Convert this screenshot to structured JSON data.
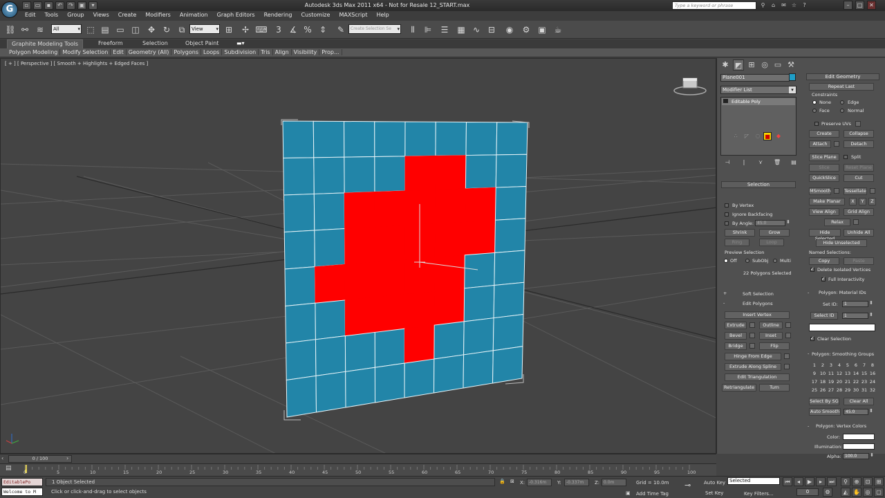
{
  "title": "Autodesk 3ds Max  2011 x64    - Not for Resale    12_START.max",
  "search_placeholder": "Type a keyword or phrase",
  "app_logo": "G",
  "menu": [
    "Edit",
    "Tools",
    "Group",
    "Views",
    "Create",
    "Modifiers",
    "Animation",
    "Graph Editors",
    "Rendering",
    "Customize",
    "MAXScript",
    "Help"
  ],
  "toolbar": {
    "selection_filter": "All",
    "ref_coord": "View",
    "named_selection": "Create Selection Se"
  },
  "ribbon": {
    "tabs": [
      "Graphite Modeling Tools",
      "Freeform",
      "Selection",
      "Object Paint"
    ],
    "sub": [
      "Polygon Modeling",
      "Modify Selection",
      "Edit",
      "Geometry (All)",
      "Polygons",
      "Loops",
      "Subdivision",
      "Tris",
      "Align",
      "Visibility",
      "Prop..."
    ]
  },
  "viewport": {
    "label": "[ + ] [ Perspective ] [ Smooth + Highlights + Edged Faces ]",
    "accent": "#2285a8",
    "selected_color": "#ff0000"
  },
  "panel": {
    "object_name": "Plane001",
    "modifier_list": "Modifier List",
    "stack_item": "Editable Poly",
    "selection": {
      "title": "Selection",
      "by_vertex": "By Vertex",
      "ignore_backfacing": "Ignore Backfacing",
      "by_angle": "By Angle:",
      "by_angle_value": "45.0",
      "shrink": "Shrink",
      "grow": "Grow",
      "ring": "Ring",
      "loop": "Loop",
      "preview_selection": "Preview Selection",
      "preview_off": "Off",
      "preview_subobj": "SubObj",
      "preview_multi": "Multi",
      "status": "22 Polygons Selected"
    },
    "soft_selection": "Soft Selection",
    "edit_polygons": {
      "title": "Edit Polygons",
      "insert_vertex": "Insert Vertex",
      "extrude": "Extrude",
      "outline": "Outline",
      "bevel": "Bevel",
      "inset": "Inset",
      "bridge": "Bridge",
      "flip": "Flip",
      "hinge_from_edge": "Hinge From Edge",
      "extrude_along_spline": "Extrude Along Spline",
      "edit_triangulation": "Edit Triangulation",
      "retriangulate": "Retriangulate",
      "turn": "Turn"
    },
    "edit_geometry": {
      "title": "Edit Geometry",
      "repeat_last": "Repeat Last",
      "constraints": "Constraints",
      "none": "None",
      "edge": "Edge",
      "face": "Face",
      "normal": "Normal",
      "preserve_uvs": "Preserve UVs",
      "create": "Create",
      "collapse": "Collapse",
      "attach": "Attach",
      "detach": "Detach",
      "slice_plane": "Slice Plane",
      "split": "Split",
      "slice": "Slice",
      "reset_plane": "Reset Plane",
      "quickslice": "QuickSlice",
      "cut": "Cut",
      "msmooth": "MSmooth",
      "tessellate": "Tessellate",
      "make_planar": "Make Planar",
      "x": "X",
      "y": "Y",
      "z": "Z",
      "view_align": "View Align",
      "grid_align": "Grid Align",
      "relax": "Relax",
      "hide_selected": "Hide Selected",
      "unhide_all": "Unhide All",
      "hide_unselected": "Hide Unselected",
      "named_selections": "Named Selections:",
      "copy": "Copy",
      "paste": "Paste",
      "delete_isolated": "Delete Isolated Vertices",
      "full_interactivity": "Full Interactivity"
    },
    "material_ids": {
      "title": "Polygon: Material IDs",
      "set_id": "Set ID:",
      "set_id_value": "1",
      "select_id": "Select ID",
      "select_id_value": "1",
      "clear_selection": "Clear Selection"
    },
    "smoothing": {
      "title": "Polygon: Smoothing Groups",
      "groups": [
        "1",
        "2",
        "3",
        "4",
        "5",
        "6",
        "7",
        "8",
        "9",
        "10",
        "11",
        "12",
        "13",
        "14",
        "15",
        "16",
        "17",
        "18",
        "19",
        "20",
        "21",
        "22",
        "23",
        "24",
        "25",
        "26",
        "27",
        "28",
        "29",
        "30",
        "31",
        "32"
      ],
      "select_by_sg": "Select By SG",
      "clear_all": "Clear All",
      "auto_smooth": "Auto Smooth",
      "auto_smooth_value": "45.0"
    },
    "vertex_colors": {
      "title": "Polygon: Vertex Colors",
      "color": "Color:",
      "illumination": "Illumination:",
      "alpha": "Alpha:",
      "alpha_value": "100.0"
    }
  },
  "timeline": {
    "frame": "0 / 100",
    "ticks": [
      "0",
      "5",
      "10",
      "15",
      "20",
      "25",
      "30",
      "35",
      "40",
      "45",
      "50",
      "55",
      "60",
      "65",
      "70",
      "75",
      "80",
      "85",
      "90",
      "95",
      "100"
    ]
  },
  "status": {
    "maxscript": "EditablePo",
    "maxscript2": "Welcome to M",
    "objects": "1 Object Selected",
    "prompt": "Click or click-and-drag to select objects",
    "x_label": "X:",
    "x_value": "-0.316m",
    "y_label": "Y:",
    "y_value": "-0.337m",
    "z_label": "Z:",
    "z_value": "0.0m",
    "grid": "Grid = 10.0m",
    "add_time_tag": "Add Time Tag",
    "auto_key": "Auto Key",
    "set_key": "Set Key",
    "selected": "Selected",
    "key_filters": "Key Filters...",
    "frame_value": "0"
  }
}
